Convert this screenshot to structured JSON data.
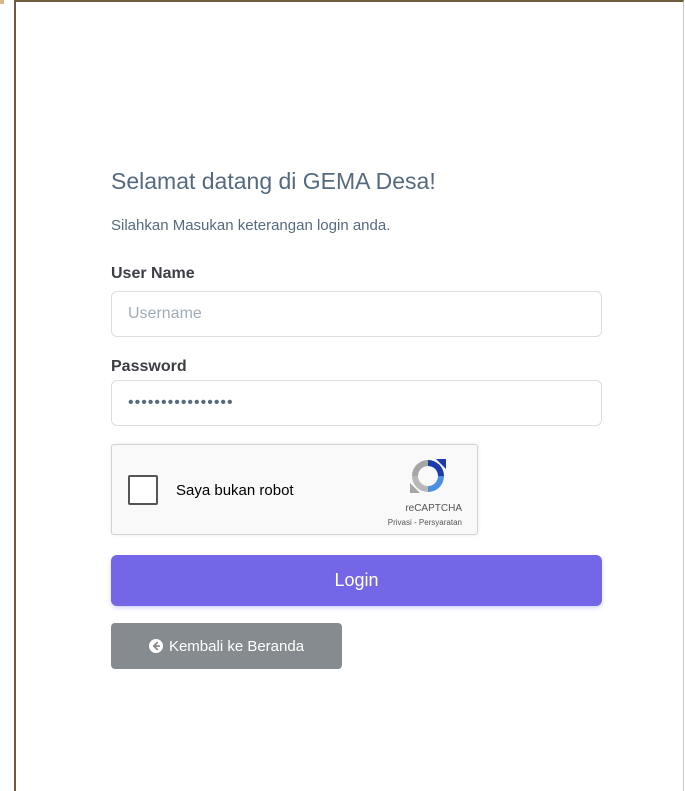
{
  "heading": {
    "welcome": "Selamat datang di GEMA Desa!",
    "subtitle": "Silahkan Masukan keterangan login anda."
  },
  "form": {
    "username_label": "User Name",
    "username_placeholder": "Username",
    "username_value": "",
    "password_label": "Password",
    "password_value": "••••••••••••••••"
  },
  "recaptcha": {
    "checkbox_label": "Saya bukan robot",
    "checked": false,
    "brand": "reCAPTCHA",
    "privacy_link": "Privasi",
    "separator": " - ",
    "terms_link": "Persyaratan",
    "icon": "recaptcha-logo-icon"
  },
  "actions": {
    "login_label": "Login",
    "back_label": "Kembali ke Beranda",
    "back_icon": "arrow-left-circle-icon"
  },
  "colors": {
    "primary": "#7367e8",
    "secondary": "#868b8f",
    "heading_text": "#566a7f"
  }
}
